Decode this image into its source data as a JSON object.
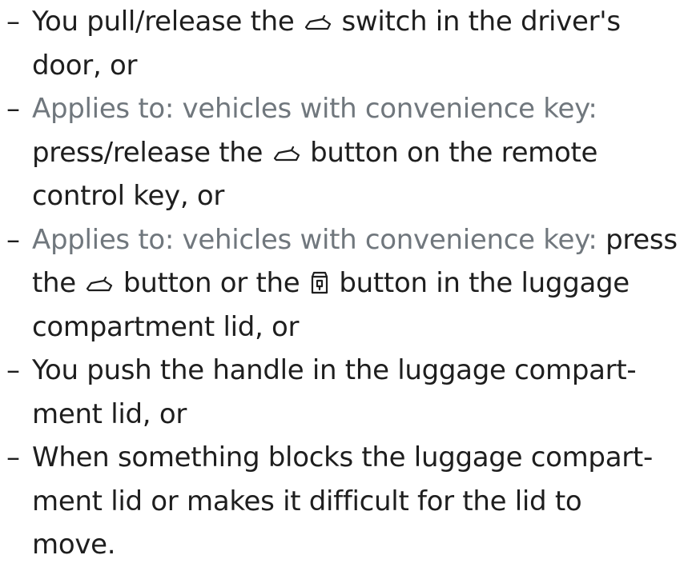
{
  "list": {
    "dash": "–",
    "items": [
      {
        "lines": [
          [
            "You pull/release the ",
            "@car-icon",
            " switch in the driver's"
          ],
          [
            "door, or"
          ]
        ]
      },
      {
        "lines": [
          [
            "~Applies to: vehicles with convenience key:"
          ],
          [
            "press/release the ",
            "@car-icon",
            " button on the remote"
          ],
          [
            "control key, or"
          ]
        ]
      },
      {
        "lines": [
          [
            "~Applies to: vehicles with convenience key:",
            " press"
          ],
          [
            "the ",
            "@car-icon",
            " button or the ",
            "@trunk-lock-icon",
            " button in the luggage"
          ],
          [
            "compartment lid, or"
          ]
        ]
      },
      {
        "lines": [
          [
            "You push the handle in the luggage compart-"
          ],
          [
            "ment lid, or"
          ]
        ]
      },
      {
        "lines": [
          [
            "When something blocks the luggage compart-"
          ],
          [
            "ment lid or makes it difficult for the lid to"
          ],
          [
            "move."
          ]
        ]
      }
    ]
  },
  "colors": {
    "text": "#1e1e1e",
    "muted": "#70777d"
  }
}
